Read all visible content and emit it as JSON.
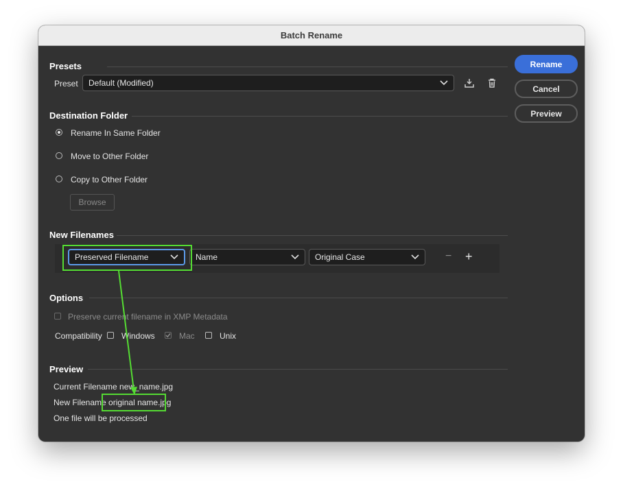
{
  "window": {
    "title": "Batch Rename"
  },
  "buttons": {
    "rename": "Rename",
    "cancel": "Cancel",
    "preview": "Preview"
  },
  "presets": {
    "section_title": "Presets",
    "preset_label": "Preset",
    "preset_value": "Default (Modified)",
    "icons": [
      "save-preset-icon",
      "delete-preset-icon"
    ]
  },
  "destination": {
    "section_title": "Destination Folder",
    "options": [
      "Rename In Same Folder",
      "Move to Other Folder",
      "Copy to Other Folder"
    ],
    "selected_index": 0,
    "browse_label": "Browse"
  },
  "new_filenames": {
    "section_title": "New Filenames",
    "field1": "Preserved Filename",
    "field2": "Name",
    "field3": "Original Case",
    "minus": "−",
    "plus": "+"
  },
  "options": {
    "section_title": "Options",
    "preserve_label": "Preserve current filename in XMP Metadata",
    "preserve_checked": false,
    "compat_label": "Compatibility",
    "windows_label": "Windows",
    "windows_checked": false,
    "mac_label": "Mac",
    "mac_checked": true,
    "unix_label": "Unix",
    "unix_checked": false
  },
  "preview": {
    "section_title": "Preview",
    "current_label": "Current Filename",
    "current_value": "new_name.jpg",
    "new_label": "New Filename",
    "new_value": "original name.jpg",
    "files_note": "One file will be processed"
  },
  "colors": {
    "accent": "#3a6fd9",
    "highlight": "#55dd33",
    "focus": "#5c9bea",
    "panel": "#323232"
  }
}
